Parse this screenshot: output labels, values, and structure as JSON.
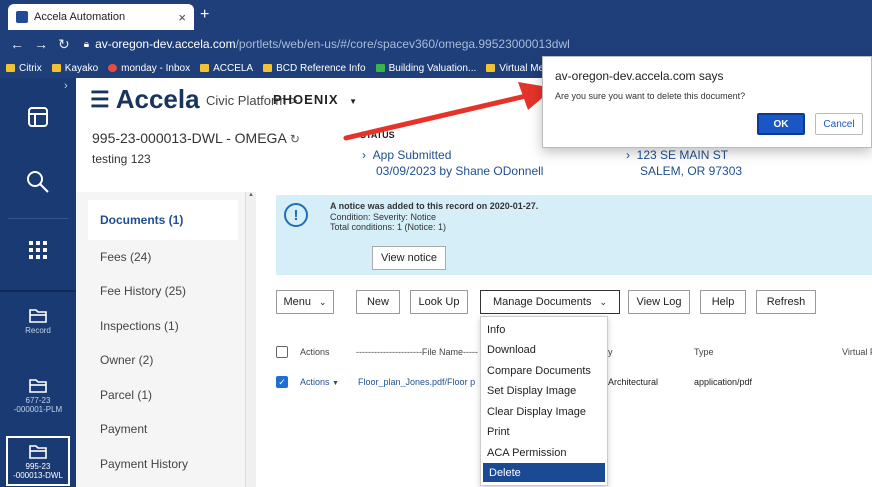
{
  "browser": {
    "tab_title": "Accela Automation",
    "new_tab": "+",
    "url_host": "av-oregon-dev.accela.com",
    "url_path": "/portlets/web/en-us/#/core/spacev360/omega.99523000013dwl",
    "bookmarks": [
      "Citrix",
      "Kayako",
      "monday - Inbox",
      "ACCELA",
      "BCD Reference Info",
      "Building Valuation...",
      "Virtual Me"
    ]
  },
  "header": {
    "logo": "Accela",
    "platform": "Civic Platform",
    "separator": ">",
    "agency": "PHOENIX"
  },
  "record": {
    "id": "995-23-000013-DWL - OMEGA",
    "description": "testing 123",
    "status_label": "STATUS",
    "status": "App Submitted",
    "status_date": "03/09/2023 by Shane ODonnell",
    "address_line1": "123 SE MAIN ST",
    "address_line2": "SALEM, OR 97303"
  },
  "rail": {
    "record_label": "Record",
    "record1": "677-23\n-000001-PLM",
    "record2": "995-23\n-000013-DWL"
  },
  "leftnav": [
    "Documents (1)",
    "Fees (24)",
    "Fee History (25)",
    "Inspections (1)",
    "Owner (2)",
    "Parcel (1)",
    "Payment",
    "Payment History"
  ],
  "notice": {
    "heading": "A notice was added to this record on 2020-01-27.",
    "line1": "Condition: Severity: Notice",
    "line2": "Total conditions: 1  (Notice: 1)",
    "button": "View notice"
  },
  "toolbar": {
    "menu": "Menu",
    "new": "New",
    "lookup": "Look Up",
    "manage": "Manage Documents",
    "viewlog": "View Log",
    "help": "Help",
    "refresh": "Refresh"
  },
  "table": {
    "col_actions": "Actions",
    "col_filename": "----------------------File Name----------------------",
    "col_category": "y",
    "col_type": "Type",
    "col_virtual": "Virtual F",
    "row": {
      "actions": "Actions",
      "filename": "Floor_plan_Jones.pdf/Floor p",
      "category": "Architectural",
      "type": "application/pdf"
    }
  },
  "dropdown": [
    "Info",
    "Download",
    "Compare Documents",
    "Set Display Image",
    "Clear Display Image",
    "Print",
    "ACA Permission",
    "Delete"
  ],
  "dialog": {
    "title": "av-oregon-dev.accela.com says",
    "message": "Are you sure you want to delete this document?",
    "ok": "OK",
    "cancel": "Cancel"
  },
  "colors": {
    "accent": "#1f4f90",
    "rail": "#1a3a73",
    "arrow": "#e5332a"
  }
}
